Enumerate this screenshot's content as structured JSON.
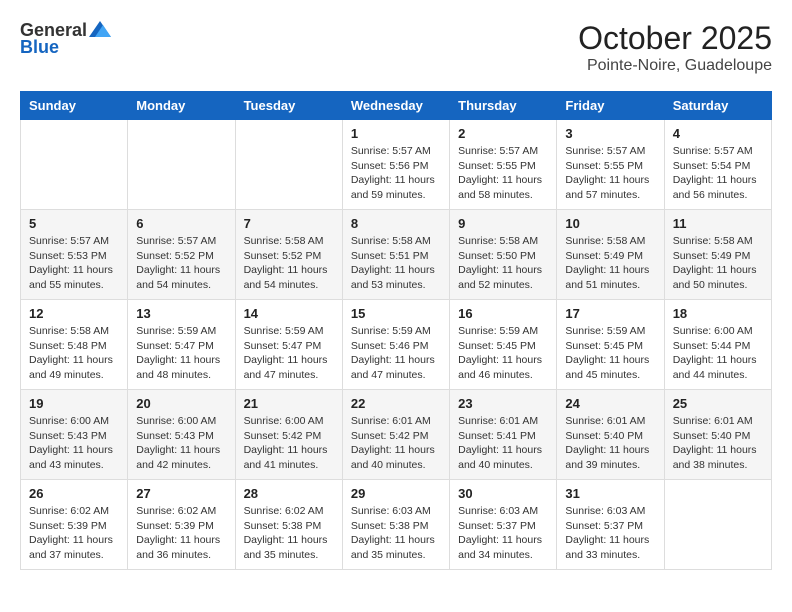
{
  "header": {
    "logo_general": "General",
    "logo_blue": "Blue",
    "month": "October 2025",
    "location": "Pointe-Noire, Guadeloupe"
  },
  "days_of_week": [
    "Sunday",
    "Monday",
    "Tuesday",
    "Wednesday",
    "Thursday",
    "Friday",
    "Saturday"
  ],
  "weeks": [
    [
      {
        "day": "",
        "info": ""
      },
      {
        "day": "",
        "info": ""
      },
      {
        "day": "",
        "info": ""
      },
      {
        "day": "1",
        "info": "Sunrise: 5:57 AM\nSunset: 5:56 PM\nDaylight: 11 hours\nand 59 minutes."
      },
      {
        "day": "2",
        "info": "Sunrise: 5:57 AM\nSunset: 5:55 PM\nDaylight: 11 hours\nand 58 minutes."
      },
      {
        "day": "3",
        "info": "Sunrise: 5:57 AM\nSunset: 5:55 PM\nDaylight: 11 hours\nand 57 minutes."
      },
      {
        "day": "4",
        "info": "Sunrise: 5:57 AM\nSunset: 5:54 PM\nDaylight: 11 hours\nand 56 minutes."
      }
    ],
    [
      {
        "day": "5",
        "info": "Sunrise: 5:57 AM\nSunset: 5:53 PM\nDaylight: 11 hours\nand 55 minutes."
      },
      {
        "day": "6",
        "info": "Sunrise: 5:57 AM\nSunset: 5:52 PM\nDaylight: 11 hours\nand 54 minutes."
      },
      {
        "day": "7",
        "info": "Sunrise: 5:58 AM\nSunset: 5:52 PM\nDaylight: 11 hours\nand 54 minutes."
      },
      {
        "day": "8",
        "info": "Sunrise: 5:58 AM\nSunset: 5:51 PM\nDaylight: 11 hours\nand 53 minutes."
      },
      {
        "day": "9",
        "info": "Sunrise: 5:58 AM\nSunset: 5:50 PM\nDaylight: 11 hours\nand 52 minutes."
      },
      {
        "day": "10",
        "info": "Sunrise: 5:58 AM\nSunset: 5:49 PM\nDaylight: 11 hours\nand 51 minutes."
      },
      {
        "day": "11",
        "info": "Sunrise: 5:58 AM\nSunset: 5:49 PM\nDaylight: 11 hours\nand 50 minutes."
      }
    ],
    [
      {
        "day": "12",
        "info": "Sunrise: 5:58 AM\nSunset: 5:48 PM\nDaylight: 11 hours\nand 49 minutes."
      },
      {
        "day": "13",
        "info": "Sunrise: 5:59 AM\nSunset: 5:47 PM\nDaylight: 11 hours\nand 48 minutes."
      },
      {
        "day": "14",
        "info": "Sunrise: 5:59 AM\nSunset: 5:47 PM\nDaylight: 11 hours\nand 47 minutes."
      },
      {
        "day": "15",
        "info": "Sunrise: 5:59 AM\nSunset: 5:46 PM\nDaylight: 11 hours\nand 47 minutes."
      },
      {
        "day": "16",
        "info": "Sunrise: 5:59 AM\nSunset: 5:45 PM\nDaylight: 11 hours\nand 46 minutes."
      },
      {
        "day": "17",
        "info": "Sunrise: 5:59 AM\nSunset: 5:45 PM\nDaylight: 11 hours\nand 45 minutes."
      },
      {
        "day": "18",
        "info": "Sunrise: 6:00 AM\nSunset: 5:44 PM\nDaylight: 11 hours\nand 44 minutes."
      }
    ],
    [
      {
        "day": "19",
        "info": "Sunrise: 6:00 AM\nSunset: 5:43 PM\nDaylight: 11 hours\nand 43 minutes."
      },
      {
        "day": "20",
        "info": "Sunrise: 6:00 AM\nSunset: 5:43 PM\nDaylight: 11 hours\nand 42 minutes."
      },
      {
        "day": "21",
        "info": "Sunrise: 6:00 AM\nSunset: 5:42 PM\nDaylight: 11 hours\nand 41 minutes."
      },
      {
        "day": "22",
        "info": "Sunrise: 6:01 AM\nSunset: 5:42 PM\nDaylight: 11 hours\nand 40 minutes."
      },
      {
        "day": "23",
        "info": "Sunrise: 6:01 AM\nSunset: 5:41 PM\nDaylight: 11 hours\nand 40 minutes."
      },
      {
        "day": "24",
        "info": "Sunrise: 6:01 AM\nSunset: 5:40 PM\nDaylight: 11 hours\nand 39 minutes."
      },
      {
        "day": "25",
        "info": "Sunrise: 6:01 AM\nSunset: 5:40 PM\nDaylight: 11 hours\nand 38 minutes."
      }
    ],
    [
      {
        "day": "26",
        "info": "Sunrise: 6:02 AM\nSunset: 5:39 PM\nDaylight: 11 hours\nand 37 minutes."
      },
      {
        "day": "27",
        "info": "Sunrise: 6:02 AM\nSunset: 5:39 PM\nDaylight: 11 hours\nand 36 minutes."
      },
      {
        "day": "28",
        "info": "Sunrise: 6:02 AM\nSunset: 5:38 PM\nDaylight: 11 hours\nand 35 minutes."
      },
      {
        "day": "29",
        "info": "Sunrise: 6:03 AM\nSunset: 5:38 PM\nDaylight: 11 hours\nand 35 minutes."
      },
      {
        "day": "30",
        "info": "Sunrise: 6:03 AM\nSunset: 5:37 PM\nDaylight: 11 hours\nand 34 minutes."
      },
      {
        "day": "31",
        "info": "Sunrise: 6:03 AM\nSunset: 5:37 PM\nDaylight: 11 hours\nand 33 minutes."
      },
      {
        "day": "",
        "info": ""
      }
    ]
  ]
}
